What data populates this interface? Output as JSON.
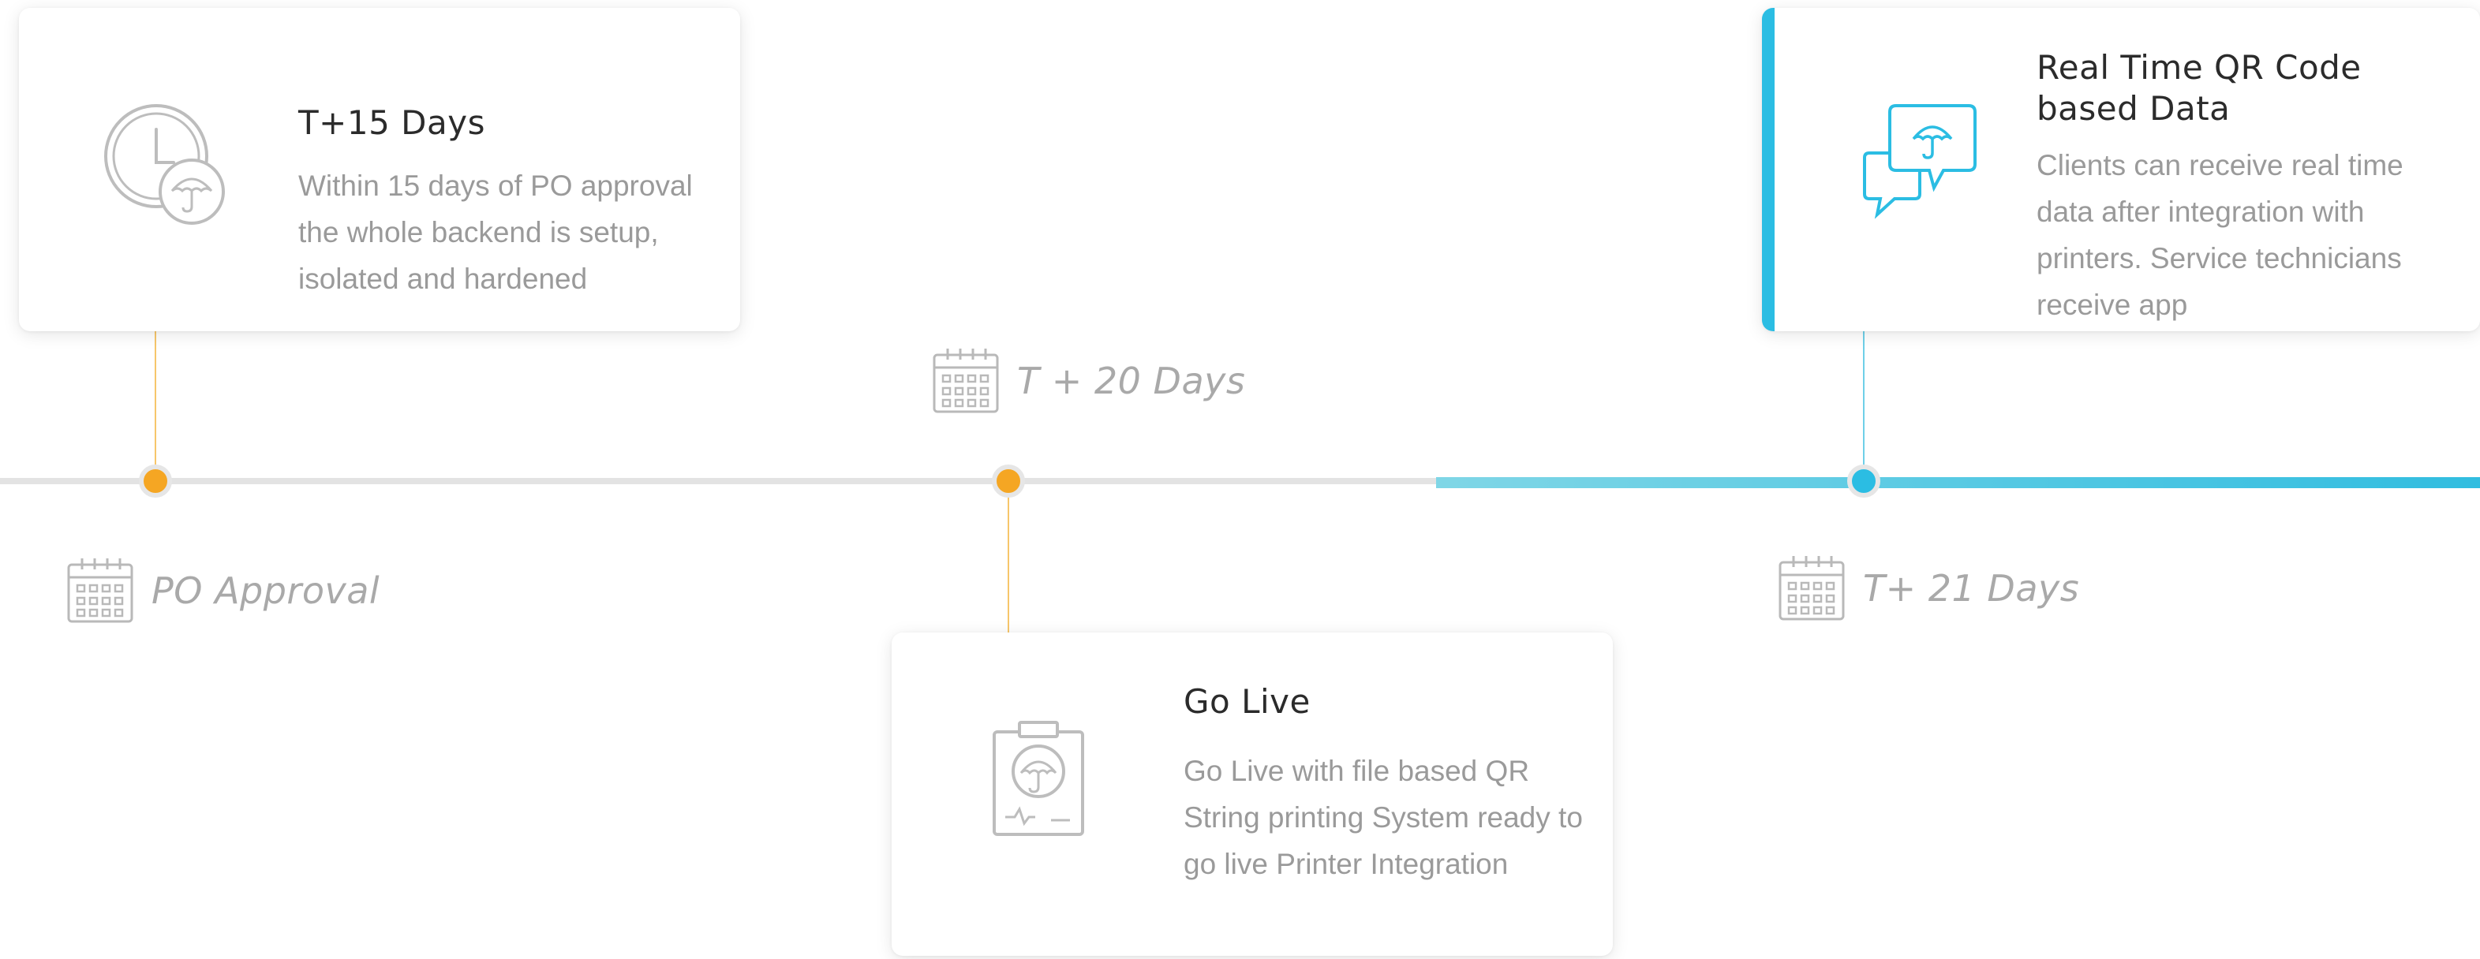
{
  "timeline": {
    "progress_color": "#2bbde3",
    "milestone_color": "#f5a623",
    "dates": {
      "po_approval": "PO Approval",
      "t20": "T + 20 Days",
      "t21": "T+ 21 Days"
    },
    "cards": {
      "t15": {
        "title": "T+15 Days",
        "description": "Within 15 days of PO approval the whole backend is setup, isolated and hardened",
        "icon": "clock-umbrella-icon"
      },
      "go_live": {
        "title": "Go Live",
        "description": "Go Live with file based QR String printing System ready to go live Printer Integration",
        "icon": "clipboard-umbrella-icon"
      },
      "realtime": {
        "title": "Real Time QR Code based Data",
        "description": "Clients can receive real time data after integration with printers. Service technicians receive app",
        "icon": "chat-umbrella-icon"
      }
    }
  }
}
